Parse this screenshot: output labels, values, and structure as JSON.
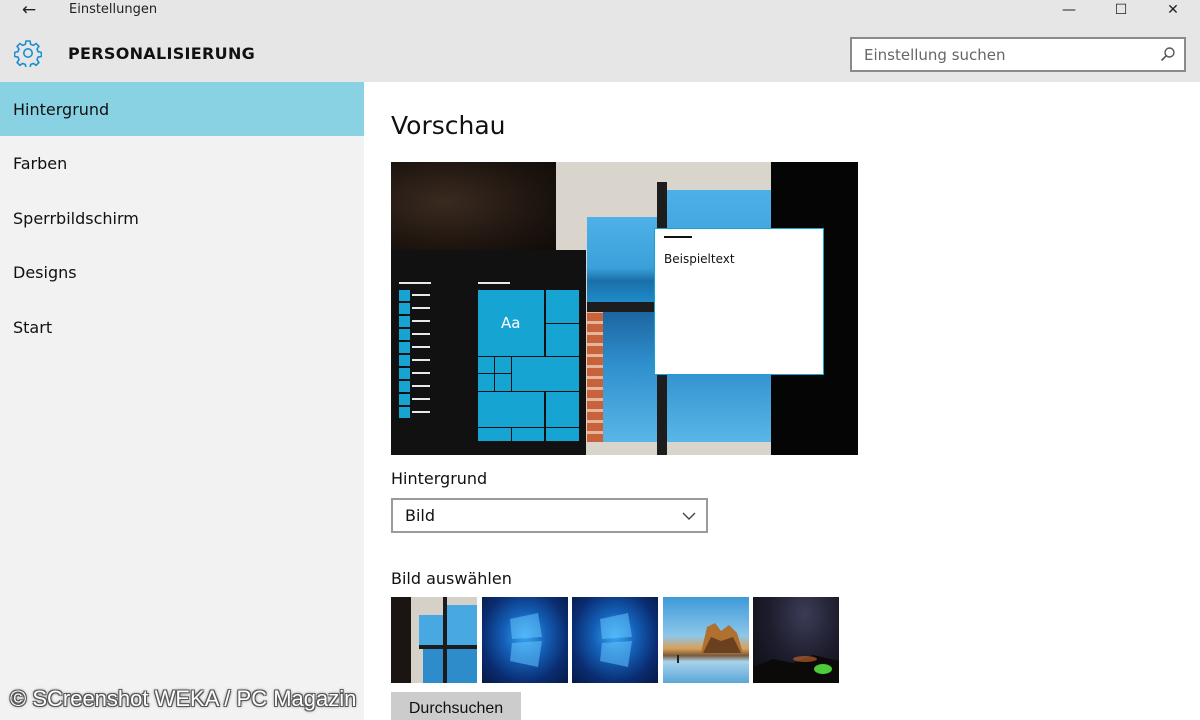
{
  "window": {
    "title": "Einstellungen",
    "back_icon": "←",
    "minimize_icon": "—",
    "maximize_icon": "☐",
    "close_icon": "✕"
  },
  "header": {
    "title": "PERSONALISIERUNG",
    "search_placeholder": "Einstellung suchen",
    "gear_color": "#1a8fd0"
  },
  "sidebar": {
    "items": [
      {
        "label": "Hintergrund",
        "active": true
      },
      {
        "label": "Farben"
      },
      {
        "label": "Sperrbildschirm"
      },
      {
        "label": "Designs"
      },
      {
        "label": "Start"
      }
    ],
    "active_color": "#89d2e3"
  },
  "main": {
    "preview_title": "Vorschau",
    "preview": {
      "tile_label": "Aa",
      "sample_text": "Beispieltext",
      "accent_color": "#16a4d2"
    },
    "background_label": "Hintergrund",
    "background_value": "Bild",
    "choose_label": "Bild auswählen",
    "browse_label": "Durchsuchen"
  },
  "watermark": "© SCreenshot WEKA / PC Magazin"
}
